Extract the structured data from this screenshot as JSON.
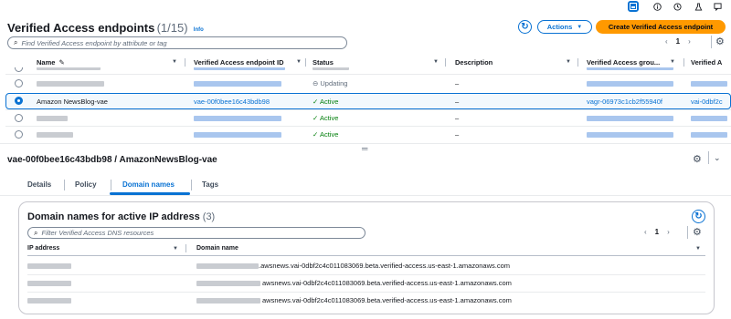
{
  "top_icons": [
    "panel-icon",
    "info-icon",
    "history-icon",
    "lab-icon",
    "feedback-icon"
  ],
  "header": {
    "title": "Verified Access endpoints",
    "count": "(1/15)",
    "info": "Info",
    "actions_label": "Actions",
    "create_label": "Create Verified Access endpoint"
  },
  "search": {
    "placeholder": "Find Verified Access endpoint by attribute or tag"
  },
  "pagination": {
    "page": "1"
  },
  "table": {
    "columns": [
      "Name",
      "Verified Access endpoint ID",
      "Status",
      "Description",
      "Verified Access grou...",
      "Verified A"
    ],
    "rows": [
      {
        "name": "",
        "id": "",
        "status": "Updating",
        "description": "–",
        "group": "",
        "va": "",
        "selected": false
      },
      {
        "name": "Amazon NewsBlog-vae",
        "id": "vae-00f0bee16c43bdb98",
        "status": "Active",
        "description": "–",
        "group": "vagr-06973c1cb2f55940f",
        "va": "vai-0dbf2c",
        "selected": true
      },
      {
        "name": "",
        "id": "",
        "status": "Active",
        "description": "–",
        "group": "",
        "va": "",
        "selected": false
      },
      {
        "name": "",
        "id": "",
        "status": "Active",
        "description": "–",
        "group": "",
        "va": "",
        "selected": false
      }
    ]
  },
  "details": {
    "title": "vae-00f0bee16c43bdb98 / AmazonNewsBlog-vae",
    "tabs": [
      "Details",
      "Policy",
      "Domain names",
      "Tags"
    ],
    "active_tab": "Domain names"
  },
  "domains": {
    "title": "Domain names for active IP address",
    "count": "(3)",
    "search_placeholder": "Filter Verified Access DNS resources",
    "page": "1",
    "columns": [
      "IP address",
      "Domain name"
    ],
    "rows": [
      {
        "domain": ".awsnews.vai-0dbf2c4c011083069.beta.verified-access.us-east-1.amazonaws.com"
      },
      {
        "domain": "awsnews.vai-0dbf2c4c011083069.beta.verified-access.us-east-1.amazonaws.com"
      },
      {
        "domain": "awsnews.vai-0dbf2c4c011083069.beta.verified-access.us-east-1.amazonaws.com"
      }
    ]
  },
  "colors": {
    "primary": "#0972d3",
    "accent": "#ff9900",
    "success": "#037f0c"
  }
}
